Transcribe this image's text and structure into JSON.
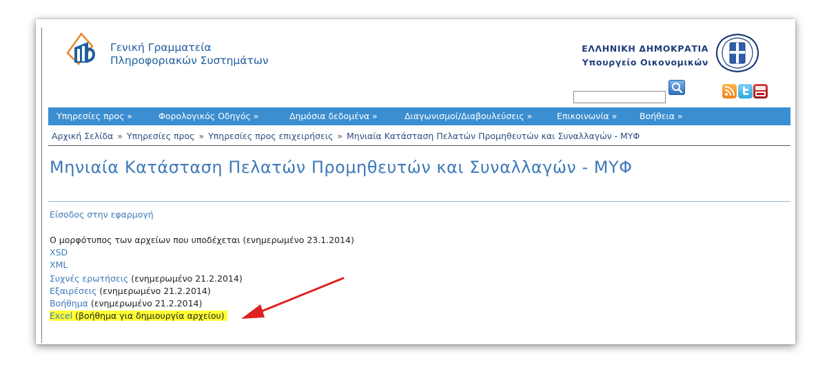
{
  "header": {
    "org_line1": "Γενική Γραμματεία",
    "org_line2": "Πληροφοριακών Συστημάτων",
    "gov_line1": "ΕΛΛΗΝΙΚΗ ΔΗΜΟΚΡΑΤΙΑ",
    "gov_line2": "Υπουργείο Οικονομικών",
    "search_value": "",
    "icons": [
      "logo-icon",
      "emblem-icon",
      "search-icon",
      "rss-icon",
      "twitter-icon",
      "youtube-icon"
    ]
  },
  "nav": {
    "items": [
      {
        "label": "Υπηρεσίες προς »"
      },
      {
        "label": "Φορολογικός Οδηγός »"
      },
      {
        "label": "Δημόσια δεδομένα »"
      },
      {
        "label": "Διαγωνισμοί/Διαβουλεύσεις »"
      },
      {
        "label": "Επικοινωνία »"
      },
      {
        "label": "Βοήθεια »"
      }
    ]
  },
  "breadcrumb": {
    "items": [
      "Αρχική Σελίδα",
      "Υπηρεσίες προς",
      "Υπηρεσίες προς επιχειρήσεις",
      "Μηνιαία Κατάσταση Πελατών Προμηθευτών και Συναλλαγών - ΜΥΦ"
    ],
    "separator": "»"
  },
  "main": {
    "title": "Μηνιαία Κατάσταση Πελατών Προμηθευτών και Συναλλαγών - ΜΥΦ",
    "login_link": "Είσοδος στην εφαρμογή",
    "format_text": "Ο μορφότυπος των αρχείων που υποδέχεται (ενημερωμένο 23.1.2014)",
    "xsd_link": "XSD",
    "xml_link": "XML",
    "faq_link": "Συχνές ερωτήσεις",
    "faq_note": " (ενημερωμένο 21.2.2014)",
    "exceptions_link": "Εξαιρέσεις",
    "exceptions_note": " (ενημερωμένο 21.2.2014)",
    "help_link": "Βοήθημα",
    "help_note": " (ενημερωμένο 21.2.2014)",
    "excel_link": "Excel",
    "excel_note": " (βοήθημα για δημιουργία αρχείου)"
  },
  "colors": {
    "nav_bg": "#3b8ed0",
    "link": "#3d79ba",
    "highlight": "#ffff33",
    "arrow": "#e02020"
  }
}
